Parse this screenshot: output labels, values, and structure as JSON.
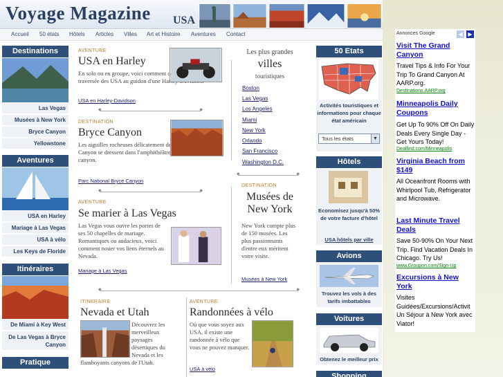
{
  "header": {
    "logo": "Voyage Magazine",
    "logo_suffix": "USA"
  },
  "nav": [
    "Accueil",
    "50 états",
    "Hôtels",
    "Articles",
    "Villes",
    "Art et Histoire",
    "Aventures",
    "Contact"
  ],
  "sidebar": {
    "destinations": {
      "title": "Destinations",
      "links": [
        "Las Vegas",
        "Musées à New York",
        "Bryce Canyon",
        "Yellowstone"
      ]
    },
    "aventures": {
      "title": "Aventures",
      "links": [
        "USA en Harley",
        "Mariage à Las Vegas",
        "USA à vélo",
        "Les Keys de Floride"
      ]
    },
    "itineraires": {
      "title": "Itinéraires",
      "links": [
        "De Miami à Key West",
        "De Las Vegas à Bryce Canyon"
      ]
    },
    "pratique": {
      "title": "Pratique"
    }
  },
  "articles": {
    "harley": {
      "kicker": "AVENTURE",
      "title": "USA en Harley",
      "text": "En solo ou en groupe, voici comment organiser votre traversée des USA au guidon d'une Harley-Davidson.",
      "link": "USA en Harley-Davidson"
    },
    "bryce": {
      "kicker": "DESTINATION",
      "title": "Bryce Canyon",
      "text": "Les aiguilles rocheuses délicatement dentelées de Bryce Canyon se dressent dans l'amphithéâtre qui forme le canyon.",
      "link": "Parc National Bryce Canyon"
    },
    "vegas": {
      "kicker": "AVENTURE",
      "title": "Se marier à Las Vegas",
      "text": "Las Vegas vous ouvre les portes de ses 50 chapelles de mariage. Romantiques ou audacieux, voici comment nouer vos liens éternels au Nevada.",
      "link": "Mariage à Las Vegas"
    },
    "utah": {
      "kicker": "ITINERAIRE",
      "title": "Nevada et Utah",
      "text": "Découvrez les merveilleux paysages désertiques du Nevada et les flamboyants canyons de l'Utah."
    },
    "velo": {
      "kicker": "AVENTURE",
      "title": "Randonnées à vélo",
      "text": "Où que vous soyez aux USA, il existe une randonnée à vélo que vous ne pouvez manquer.",
      "link": "USA à vélo"
    },
    "nymusees": {
      "kicker": "DESTINATION",
      "title": "Musées de New York",
      "text": "New York compte plus de 150 musées. Les plus passionnants d'entre eux méritent votre visite.",
      "link": "Musées à New York"
    }
  },
  "villes": {
    "pre": "Les plus grandes",
    "title": "villes",
    "post": "touristiques",
    "list": [
      "Boston",
      "Las Vegas",
      "Los Angeles",
      "Miami",
      "New York",
      "Orlando",
      "San Francisco",
      "Washington D.C."
    ]
  },
  "right": {
    "etats": {
      "title": "50 Etats",
      "text": "Activités touristiques et informations pour chaque état américain",
      "select": "Tous les états"
    },
    "hotels": {
      "title": "Hôtels",
      "text": "Economisez jusqu'à 50% de votre facture d'hôtel",
      "link": "USA hôtels par ville"
    },
    "avions": {
      "title": "Avions",
      "text": "Trouvez les vols à des tarifs imbattables"
    },
    "voitures": {
      "title": "Voitures",
      "text": "Obtenez le meilleur prix"
    },
    "shopping": {
      "title": "Shopping"
    }
  },
  "ads": {
    "label": "Annonces Google",
    "items": [
      {
        "title": "Visit The Grand Canyon",
        "body": "Travel Tips & Info For Your Trip To Grand Canyon At AARP.org.",
        "url": "Destinations.AARP.org"
      },
      {
        "title": "Minneapolis Daily Coupons",
        "body": "Get Up To 90% Off On Daily Deals Every Single Day - Get Yours Today!",
        "url": "Dealfind.com/Minneapolis"
      },
      {
        "title": "Virginia Beach from $149",
        "body": "All Oceanfront Rooms with Whirlpool Tub, Refrigerator and Microwave.",
        "url": ""
      },
      {
        "title": "Last Minute Travel Deals",
        "body": "Save 50-90% On Your Next Trip. Find Vacation Deals In Chicago. Try Us!",
        "url": "www.Groupon.com/Sign-Up"
      },
      {
        "title": "Excursions à New York",
        "body": "Visites Guidées/Excursions/Activit Un Séjour à New York avec Viator!",
        "url": ""
      }
    ]
  },
  "colors": {
    "header_blue": "#2e4f7a",
    "accent": "#c07a2a",
    "link": "#1a1a6a",
    "ad_link": "#1111cc",
    "ad_url": "#008000"
  }
}
